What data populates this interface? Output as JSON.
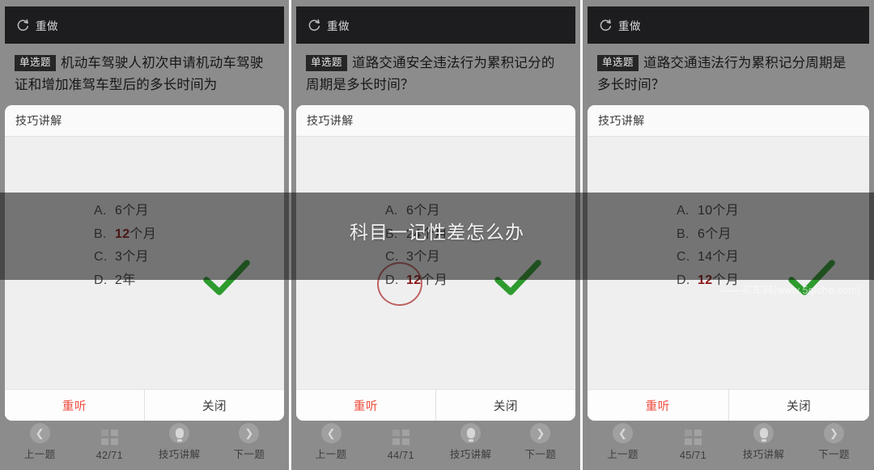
{
  "meta": {
    "overlay_band_text": "科目一记性差怎么办",
    "watermark": "——买车网(www.5qiche.com)",
    "accent_red": "#ef4a3c",
    "answer_red": "#8e1616",
    "check_green": "#2e9b2e",
    "topbar_bg": "#1d1d1f",
    "panel_bg": "#8c8c8c"
  },
  "panels": [
    {
      "topbar": {
        "icon": "redo-circular-arrow-icon",
        "label": "重做"
      },
      "question": {
        "tag": "单选题",
        "text": "机动车驾驶人初次申请机动车驾驶证和增加准驾车型后的多长时间为"
      },
      "card": {
        "head_title": "技巧讲解",
        "options": [
          {
            "label": "A.",
            "num": "6",
            "suffix": "个月",
            "highlight": false
          },
          {
            "label": "B.",
            "num": "12",
            "suffix": "个月",
            "highlight": true
          },
          {
            "label": "C.",
            "num": "3",
            "suffix": "个月",
            "highlight": false
          },
          {
            "label": "D.",
            "num": "2",
            "suffix": "年",
            "highlight": false
          }
        ],
        "annotated_option_index": -1,
        "footer": {
          "replay": "重听",
          "close": "关闭"
        }
      },
      "nav": {
        "prev_label": "上一题",
        "counter": "42/71",
        "tips_label": "技巧讲解",
        "next_label": "下一题"
      }
    },
    {
      "topbar": {
        "icon": "redo-circular-arrow-icon",
        "label": "重做"
      },
      "question": {
        "tag": "单选题",
        "text": "道路交通安全违法行为累积记分的周期是多长时间？"
      },
      "card": {
        "head_title": "技巧讲解",
        "options": [
          {
            "label": "A.",
            "num": "6",
            "suffix": "个月",
            "highlight": false
          },
          {
            "label": "B.",
            "num": "24",
            "suffix": "个月",
            "highlight": false
          },
          {
            "label": "C.",
            "num": "3",
            "suffix": "个月",
            "highlight": false
          },
          {
            "label": "D.",
            "num": "12",
            "suffix": "个月",
            "highlight": true
          }
        ],
        "annotated_option_index": 3,
        "footer": {
          "replay": "重听",
          "close": "关闭"
        }
      },
      "nav": {
        "prev_label": "上一题",
        "counter": "44/71",
        "tips_label": "技巧讲解",
        "next_label": "下一题"
      }
    },
    {
      "topbar": {
        "icon": "redo-circular-arrow-icon",
        "label": "重做"
      },
      "question": {
        "tag": "单选题",
        "text": "道路交通违法行为累积记分周期是多长时间？"
      },
      "card": {
        "head_title": "技巧讲解",
        "options": [
          {
            "label": "A.",
            "num": "10",
            "suffix": "个月",
            "highlight": false
          },
          {
            "label": "B.",
            "num": "6",
            "suffix": "个月",
            "highlight": false
          },
          {
            "label": "C.",
            "num": "14",
            "suffix": "个月",
            "highlight": false
          },
          {
            "label": "D.",
            "num": "12",
            "suffix": "个月",
            "highlight": true
          }
        ],
        "annotated_option_index": -1,
        "footer": {
          "replay": "重听",
          "close": "关闭"
        }
      },
      "nav": {
        "prev_label": "上一题",
        "counter": "45/71",
        "tips_label": "技巧讲解",
        "next_label": "下一题"
      }
    }
  ]
}
